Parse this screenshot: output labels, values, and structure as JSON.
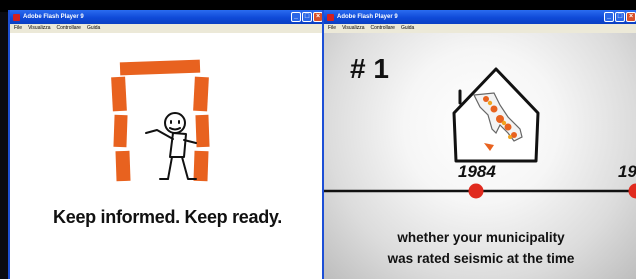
{
  "left_window": {
    "title": "Adobe Flash Player 9",
    "menu": [
      "File",
      "Visualizza",
      "Controllare",
      "Guida"
    ],
    "tagline": "Keep informed. Keep ready."
  },
  "right_window": {
    "title": "Adobe Flash Player 9",
    "menu": [
      "File",
      "Visualizza",
      "Controllare",
      "Guida"
    ],
    "rank_label": "# 1",
    "timeline_year": "1984",
    "timeline_next_year_partial": "19",
    "description_line1": "whether your municipality",
    "description_line2": "was rated seismic at the time"
  },
  "titlebar_buttons": [
    "_",
    "□",
    "×"
  ],
  "colors": {
    "accent": "#e8621f",
    "marker": "#e02a1e",
    "titlebar": "#0f4ad8"
  }
}
